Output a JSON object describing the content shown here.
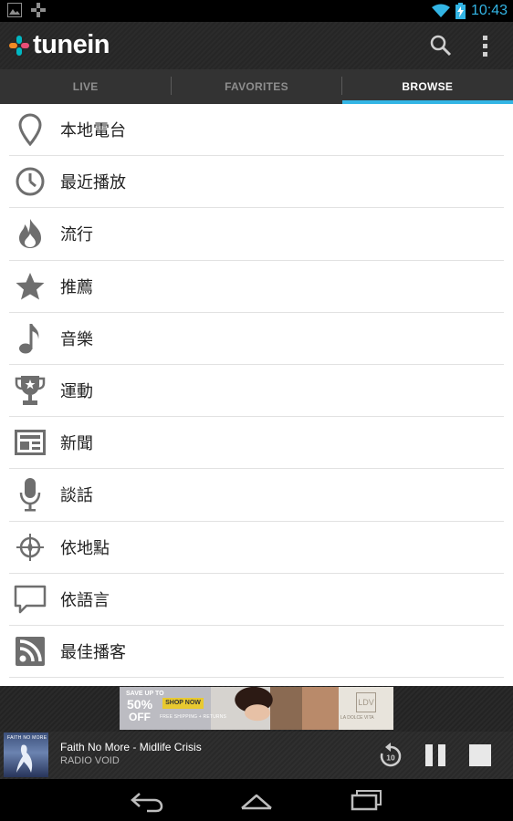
{
  "status_bar": {
    "time": "10:43",
    "notification_icons": [
      "gallery-icon",
      "tunein-notification-icon"
    ],
    "system_icons": [
      "wifi-icon",
      "battery-charging-icon"
    ]
  },
  "app": {
    "logo_text": "tunein",
    "accent_color": "#33b5e5",
    "logo_colors": [
      "#f08a24",
      "#00b7c2",
      "#e94e77"
    ]
  },
  "actions": {
    "search_icon": "search-icon",
    "overflow_icon": "overflow-menu-icon"
  },
  "tabs": [
    {
      "label": "LIVE",
      "active": false
    },
    {
      "label": "FAVORITES",
      "active": false
    },
    {
      "label": "BROWSE",
      "active": true
    }
  ],
  "browse_items": [
    {
      "label": "本地電台",
      "icon": "location-pin-icon"
    },
    {
      "label": "最近播放",
      "icon": "clock-icon"
    },
    {
      "label": "流行",
      "icon": "flame-icon"
    },
    {
      "label": "推薦",
      "icon": "star-icon"
    },
    {
      "label": "音樂",
      "icon": "music-note-icon"
    },
    {
      "label": "運動",
      "icon": "trophy-icon"
    },
    {
      "label": "新聞",
      "icon": "newspaper-icon"
    },
    {
      "label": "談話",
      "icon": "microphone-icon"
    },
    {
      "label": "依地點",
      "icon": "compass-icon"
    },
    {
      "label": "依語言",
      "icon": "speech-bubble-icon"
    },
    {
      "label": "最佳播客",
      "icon": "rss-icon"
    }
  ],
  "ad": {
    "save_text": "SAVE UP TO",
    "percent_text": "50%",
    "off_text": "OFF",
    "cta": "SHOP NOW",
    "fine_print": "FREE SHIPPING + RETURNS",
    "brand_logo": "LDV",
    "brand_tagline": "LA DOLCE VITA"
  },
  "now_playing": {
    "title": "Faith No More - Midlife Crisis",
    "station": "RADIO VOID",
    "album_art_text": "FAITH NO MORE",
    "rewind_label": "10"
  },
  "nav": {
    "back_icon": "back-icon",
    "home_icon": "home-icon",
    "recents_icon": "recent-apps-icon"
  }
}
